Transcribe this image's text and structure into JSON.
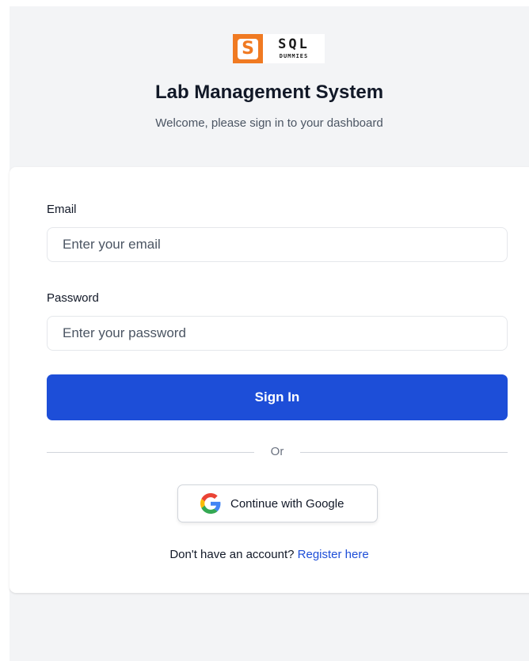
{
  "brand": {
    "logo_letter": "S",
    "logo_sql": "SQL",
    "logo_dummies": "DUMMIES",
    "accent_color": "#f07a22"
  },
  "header": {
    "title": "Lab Management System",
    "subtitle": "Welcome, please sign in to your dashboard"
  },
  "form": {
    "email_label": "Email",
    "email_placeholder": "Enter your email",
    "email_value": "",
    "password_label": "Password",
    "password_placeholder": "Enter your password",
    "password_value": "",
    "signin_label": "Sign In",
    "primary_color": "#1d4ed8"
  },
  "divider": {
    "text": "Or"
  },
  "oauth": {
    "google_label": "Continue with Google",
    "icon": "google-icon"
  },
  "footer": {
    "register_prompt": "Don't have an account?",
    "register_link": "Register here"
  }
}
